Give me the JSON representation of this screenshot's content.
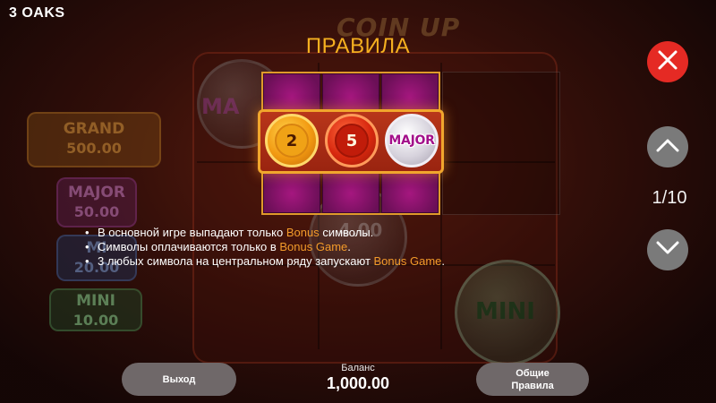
{
  "header": {
    "game_title": "3 OAKS",
    "rules_title": "ПРАВИЛА",
    "logo_text": "COIN UP"
  },
  "controls": {
    "close_icon": "close-icon",
    "prev_icon": "chevron-up-icon",
    "next_icon": "chevron-down-icon",
    "page_counter": "1/10"
  },
  "background_jackpots": [
    {
      "name": "GRAND",
      "value": "500.00"
    },
    {
      "name": "MAJOR",
      "value": "50.00"
    },
    {
      "name": "MI",
      "value": "20.00"
    },
    {
      "name": "MINI",
      "value": "10.00"
    }
  ],
  "background_symbols": {
    "left_coin": "MA",
    "center_coin": "4.00",
    "right_coin": "MINI"
  },
  "illustration": {
    "coins": [
      {
        "type": "number",
        "label": "2",
        "color": "gold"
      },
      {
        "type": "number",
        "label": "5",
        "color": "red"
      },
      {
        "type": "jackpot",
        "label": "MAJOR",
        "color": "silver"
      }
    ]
  },
  "rules": [
    {
      "before": "В основной игре выпадают только ",
      "highlight": "Bonus",
      "after": " символы."
    },
    {
      "before": "Символы оплачиваются только в ",
      "highlight": "Bonus Game",
      "after": "."
    },
    {
      "before": "3 любых символа на центральном ряду запускают ",
      "highlight": "Bonus Game",
      "after": "."
    }
  ],
  "footer": {
    "exit_label": "Выход",
    "balance_label": "Баланс",
    "balance_value": "1,000.00",
    "general_rules_label": "Общие Правила"
  },
  "colors": {
    "accent": "#f5b020",
    "highlight": "#f29a2a",
    "close_button": "#e52a24",
    "nav_button": "#7a7a7a",
    "footer_button": "#6f6869",
    "cell": "#a5177f"
  }
}
